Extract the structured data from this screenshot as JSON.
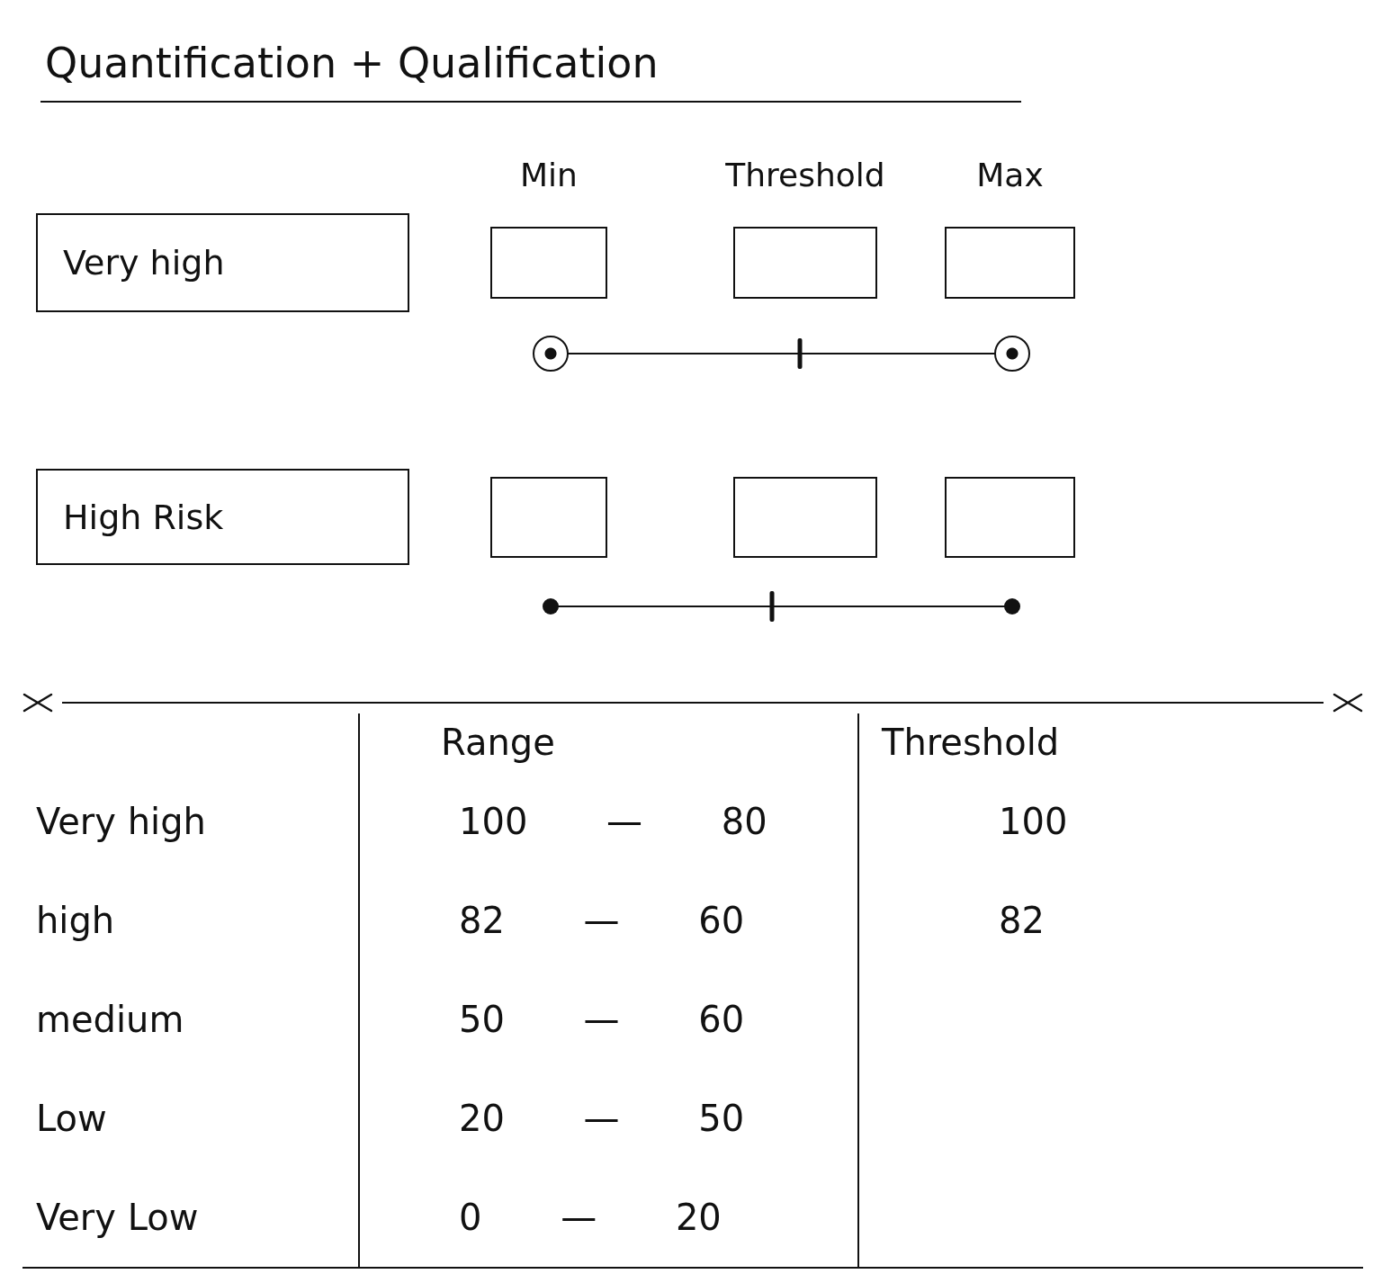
{
  "title": "Quantification + Qualification",
  "controls": {
    "columns": [
      "Min",
      "Threshold",
      "Max"
    ],
    "rows": [
      {
        "label": "Very high",
        "slider": {
          "handles": [
            {
              "kind": "ring",
              "level": 0
            },
            {
              "kind": "tick",
              "level": 0.54
            },
            {
              "kind": "ring",
              "level": 1
            }
          ]
        }
      },
      {
        "label": "High Risk",
        "slider": {
          "handles": [
            {
              "kind": "dot",
              "level": 0
            },
            {
              "kind": "tick",
              "level": 0.48
            },
            {
              "kind": "dot",
              "level": 1
            }
          ]
        }
      }
    ]
  },
  "table": {
    "columns": [
      "Range",
      "Threshold"
    ],
    "rows": [
      {
        "risk": "Very high",
        "range": "100 — 80",
        "threshold": "100"
      },
      {
        "risk": "high",
        "range": "82 — 60",
        "threshold": "82"
      },
      {
        "risk": "medium",
        "range": "50 — 60"
      },
      {
        "risk": "Low",
        "range": "20 — 50"
      },
      {
        "risk": "Very Low",
        "range": "0 — 20"
      }
    ]
  }
}
